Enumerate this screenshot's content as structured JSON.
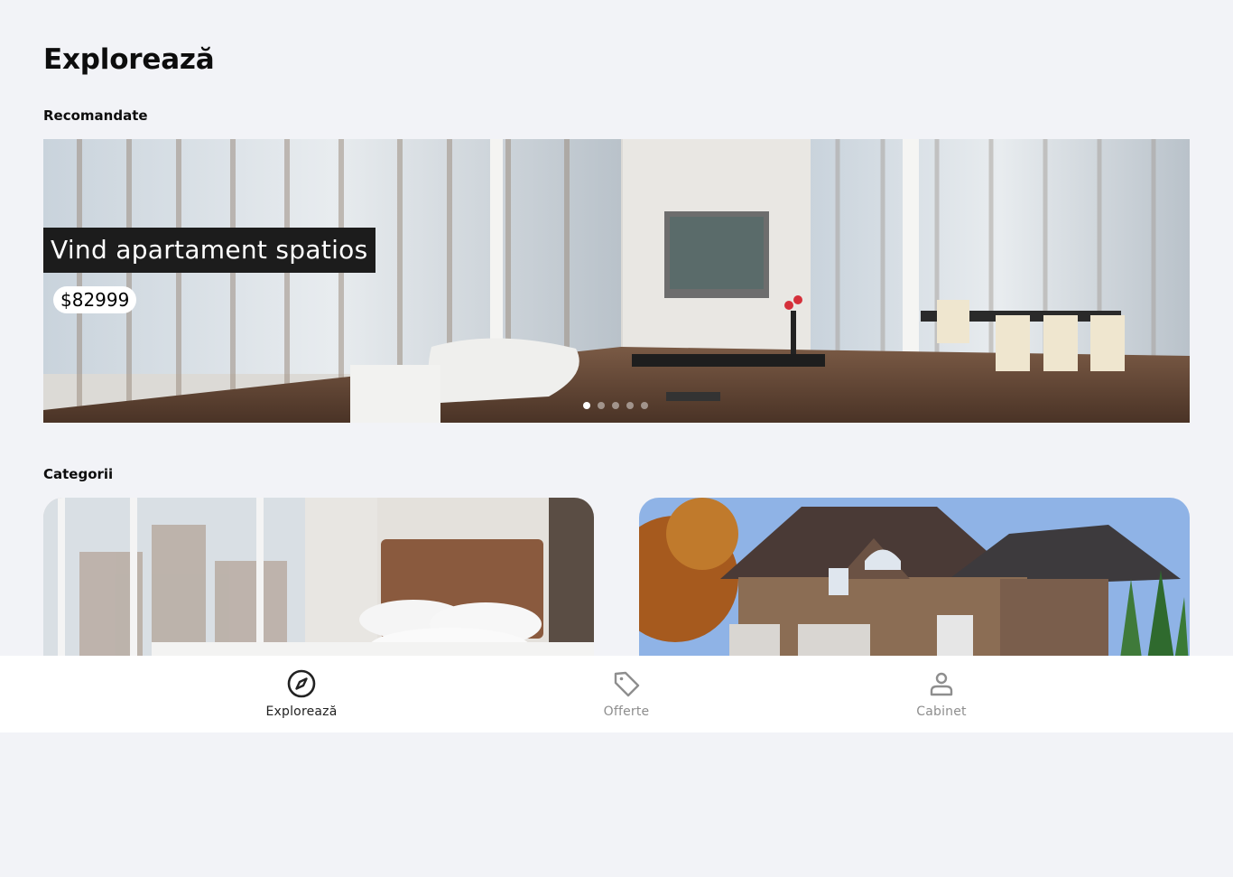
{
  "header": {
    "title": "Explorează"
  },
  "recommended": {
    "label": "Recomandate",
    "slide": {
      "title": "Vind apartament spatios",
      "price": "$82999"
    },
    "slide_count": 5,
    "active_slide": 0
  },
  "categories": {
    "label": "Categorii",
    "items": [
      {
        "name": "bedroom-interior"
      },
      {
        "name": "house-exterior"
      }
    ]
  },
  "tabbar": {
    "tabs": [
      {
        "label": "Explorează",
        "icon": "compass-icon",
        "active": true
      },
      {
        "label": "Offerte",
        "icon": "tag-icon",
        "active": false
      },
      {
        "label": "Cabinet",
        "icon": "user-icon",
        "active": false
      }
    ]
  },
  "colors": {
    "background": "#f2f3f7",
    "tab_active": "#222222",
    "tab_inactive": "#8e8e8e",
    "title_banner": "#1c1c1c"
  }
}
